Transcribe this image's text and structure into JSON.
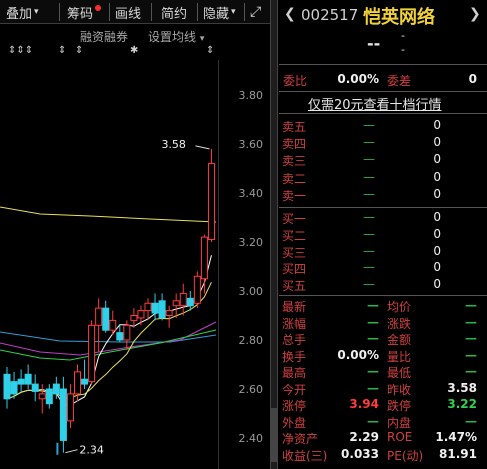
{
  "toolbar": {
    "overlay_label": "叠加",
    "chips_label": "筹码",
    "draw_label": "画线",
    "brief_label": "简约",
    "hide_label": "隐藏",
    "expand_glyph": "⤢",
    "margin_label": "融资融券",
    "ma_settings_label": "设置均线",
    "ma_caret": "▾",
    "subbar_caret": "▾",
    "chips_dot_color": "#ff2b2b"
  },
  "stock": {
    "code": "002517",
    "name": "恺英网络",
    "nav_prev": "❮",
    "nav_next": "❯",
    "price": "--",
    "change": "-",
    "change_pct": "-"
  },
  "marks": {
    "m1": "⇕⇕⇕",
    "m2": "⇕",
    "m3": "⇕",
    "m4": "✱",
    "m5": "⇕"
  },
  "axis": {
    "t380": "3.80",
    "t360": "3.60",
    "t340": "3.40",
    "t320": "3.20",
    "t300": "3.00",
    "t280": "2.80",
    "t260": "2.60",
    "t240": "2.40"
  },
  "annotations": {
    "high": "3.58",
    "low": "2.34"
  },
  "ratio": {
    "label1": "委比",
    "value1": "0.00%",
    "label2": "委差",
    "value2": "0"
  },
  "promo": "仅需20元查看十档行情",
  "orderbook": {
    "sell": [
      {
        "label": "卖五",
        "dash": "—",
        "qty": "0"
      },
      {
        "label": "卖四",
        "dash": "—",
        "qty": "0"
      },
      {
        "label": "卖三",
        "dash": "—",
        "qty": "0"
      },
      {
        "label": "卖二",
        "dash": "—",
        "qty": "0"
      },
      {
        "label": "卖一",
        "dash": "—",
        "qty": "0"
      }
    ],
    "buy": [
      {
        "label": "买一",
        "dash": "—",
        "qty": "0"
      },
      {
        "label": "买二",
        "dash": "—",
        "qty": "0"
      },
      {
        "label": "买三",
        "dash": "—",
        "qty": "0"
      },
      {
        "label": "买四",
        "dash": "—",
        "qty": "0"
      },
      {
        "label": "买五",
        "dash": "—",
        "qty": "0"
      }
    ]
  },
  "stats": [
    {
      "l1": "最新",
      "v1": "—",
      "l2": "均价",
      "v2": "—",
      "c1": "#2fb04a",
      "c2": "#2fb04a"
    },
    {
      "l1": "涨幅",
      "v1": "—",
      "l2": "涨跌",
      "v2": "—",
      "c1": "#2fb04a",
      "c2": "#2fb04a"
    },
    {
      "l1": "总手",
      "v1": "—",
      "l2": "金额",
      "v2": "—",
      "c1": "#2fb04a",
      "c2": "#2fb04a"
    },
    {
      "l1": "换手",
      "v1": "0.00%",
      "l2": "量比",
      "v2": "—",
      "c1": "#f0f0f0",
      "c2": "#2fb04a"
    },
    {
      "l1": "最高",
      "v1": "—",
      "l2": "最低",
      "v2": "—",
      "c1": "#2fb04a",
      "c2": "#2fb04a"
    },
    {
      "l1": "今开",
      "v1": "—",
      "l2": "昨收",
      "v2": "3.58",
      "c1": "#2fb04a",
      "c2": "#f0f0f0"
    },
    {
      "l1": "涨停",
      "v1": "3.94",
      "l2": "跌停",
      "v2": "3.22",
      "c1": "#ff3b3b",
      "c2": "#2fd24a"
    },
    {
      "l1": "外盘",
      "v1": "—",
      "l2": "内盘",
      "v2": "—",
      "c1": "#2fb04a",
      "c2": "#2fb04a"
    },
    {
      "l1": "净资产",
      "v1": "2.29",
      "l2": "ROE",
      "v2": "1.47%",
      "c1": "#f0f0f0",
      "c2": "#f0f0f0"
    },
    {
      "l1": "收益(三)",
      "v1": "0.033",
      "l2": "PE(动)",
      "v2": "81.91",
      "c1": "#f0f0f0",
      "c2": "#f0f0f0"
    }
  ],
  "chart_data": {
    "type": "candlestick",
    "ylim": [
      2.31,
      3.9
    ],
    "yticks": [
      3.8,
      3.6,
      3.4,
      3.2,
      3.0,
      2.8,
      2.6,
      2.4
    ],
    "candles": [
      {
        "o": 2.66,
        "h": 2.69,
        "l": 2.52,
        "c": 2.56
      },
      {
        "o": 2.63,
        "h": 2.67,
        "l": 2.56,
        "c": 2.58
      },
      {
        "o": 2.64,
        "h": 2.68,
        "l": 2.59,
        "c": 2.62
      },
      {
        "o": 2.66,
        "h": 2.7,
        "l": 2.6,
        "c": 2.62
      },
      {
        "o": 2.62,
        "h": 2.66,
        "l": 2.55,
        "c": 2.59
      },
      {
        "o": 2.56,
        "h": 2.62,
        "l": 2.5,
        "c": 2.58
      },
      {
        "o": 2.6,
        "h": 2.62,
        "l": 2.52,
        "c": 2.54
      },
      {
        "o": 2.62,
        "h": 2.65,
        "l": 2.56,
        "c": 2.58
      },
      {
        "o": 2.6,
        "h": 2.65,
        "l": 2.34,
        "c": 2.39
      },
      {
        "o": 2.47,
        "h": 2.62,
        "l": 2.44,
        "c": 2.58
      },
      {
        "o": 2.58,
        "h": 2.7,
        "l": 2.55,
        "c": 2.67
      },
      {
        "o": 2.64,
        "h": 2.72,
        "l": 2.6,
        "c": 2.62
      },
      {
        "o": 2.63,
        "h": 2.88,
        "l": 2.62,
        "c": 2.86
      },
      {
        "o": 2.86,
        "h": 2.97,
        "l": 2.75,
        "c": 2.93
      },
      {
        "o": 2.93,
        "h": 2.96,
        "l": 2.83,
        "c": 2.84
      },
      {
        "o": 2.84,
        "h": 2.92,
        "l": 2.82,
        "c": 2.88
      },
      {
        "o": 2.83,
        "h": 2.86,
        "l": 2.79,
        "c": 2.8
      },
      {
        "o": 2.8,
        "h": 2.88,
        "l": 2.76,
        "c": 2.86
      },
      {
        "o": 2.88,
        "h": 2.93,
        "l": 2.85,
        "c": 2.9
      },
      {
        "o": 2.89,
        "h": 2.94,
        "l": 2.86,
        "c": 2.92
      },
      {
        "o": 2.92,
        "h": 2.97,
        "l": 2.88,
        "c": 2.95
      },
      {
        "o": 2.95,
        "h": 2.99,
        "l": 2.88,
        "c": 2.91
      },
      {
        "o": 2.96,
        "h": 2.99,
        "l": 2.88,
        "c": 2.89
      },
      {
        "o": 2.9,
        "h": 2.94,
        "l": 2.85,
        "c": 2.92
      },
      {
        "o": 2.94,
        "h": 2.99,
        "l": 2.89,
        "c": 2.96
      },
      {
        "o": 2.94,
        "h": 3.03,
        "l": 2.9,
        "c": 2.99
      },
      {
        "o": 2.97,
        "h": 3.0,
        "l": 2.92,
        "c": 2.94
      },
      {
        "o": 2.95,
        "h": 3.08,
        "l": 2.93,
        "c": 3.06
      },
      {
        "o": 3.05,
        "h": 3.23,
        "l": 2.99,
        "c": 3.22
      },
      {
        "o": 3.21,
        "h": 3.58,
        "l": 3.2,
        "c": 3.52
      }
    ]
  }
}
